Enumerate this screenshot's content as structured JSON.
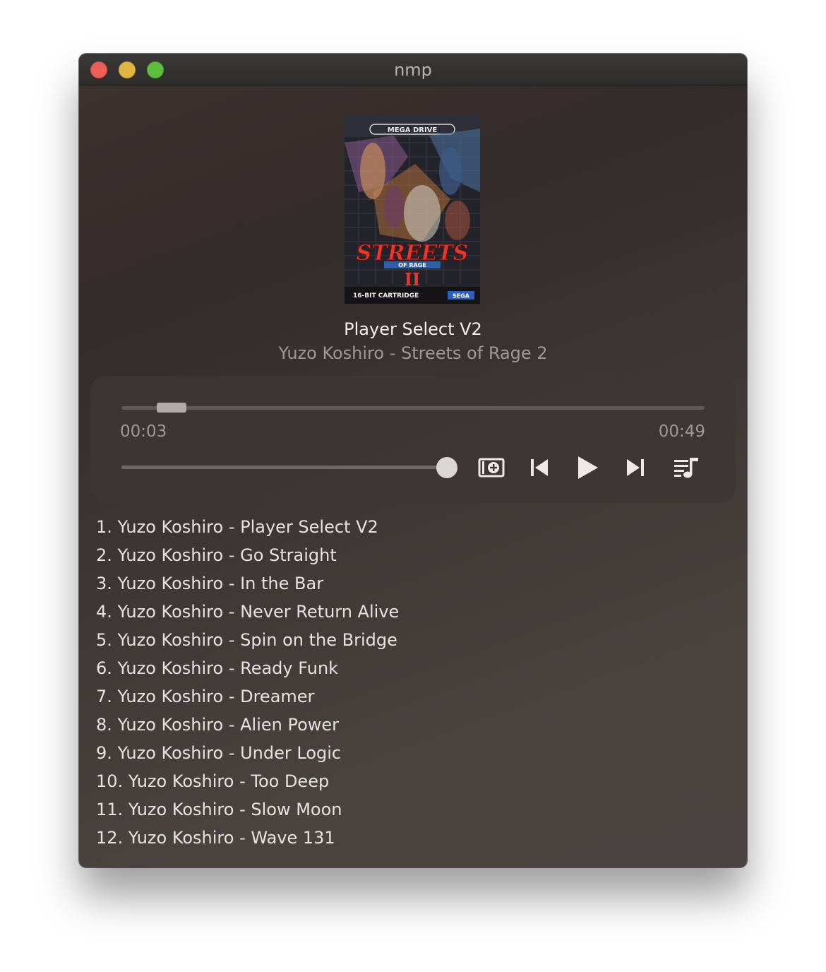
{
  "window": {
    "title": "nmp"
  },
  "now_playing": {
    "title": "Player Select V2",
    "subtitle": "Yuzo Koshiro - Streets of Rage 2",
    "cover_alt": "Streets of Rage II Mega Drive cover art",
    "cover_text": {
      "brand": "MEGA DRIVE",
      "logo_line1": "STREETS",
      "logo_line2": "OF RAGE",
      "logo_numeral": "II",
      "cartridge": "16-BIT CARTRIDGE",
      "publisher": "SEGA"
    }
  },
  "player": {
    "elapsed": "00:03",
    "duration": "00:49",
    "progress": 0.061,
    "volume": 1.0,
    "controls": {
      "add": "add-to-playlist-icon",
      "previous": "previous-icon",
      "play": "play-icon",
      "next": "next-icon",
      "playlist": "playlist-icon"
    }
  },
  "playlist": [
    "1. Yuzo Koshiro - Player Select V2",
    "2. Yuzo Koshiro - Go Straight",
    "3. Yuzo Koshiro - In the Bar",
    "4. Yuzo Koshiro - Never Return Alive",
    "5. Yuzo Koshiro - Spin on the Bridge",
    "6. Yuzo Koshiro - Ready Funk",
    "7. Yuzo Koshiro - Dreamer",
    "8. Yuzo Koshiro - Alien Power",
    "9. Yuzo Koshiro - Under Logic",
    "10. Yuzo Koshiro - Too Deep",
    "11. Yuzo Koshiro - Slow Moon",
    "12. Yuzo Koshiro - Wave 131"
  ],
  "colors": {
    "close": "#ec5f57",
    "minimize": "#e0b53f",
    "maximize": "#5cbf3e"
  }
}
